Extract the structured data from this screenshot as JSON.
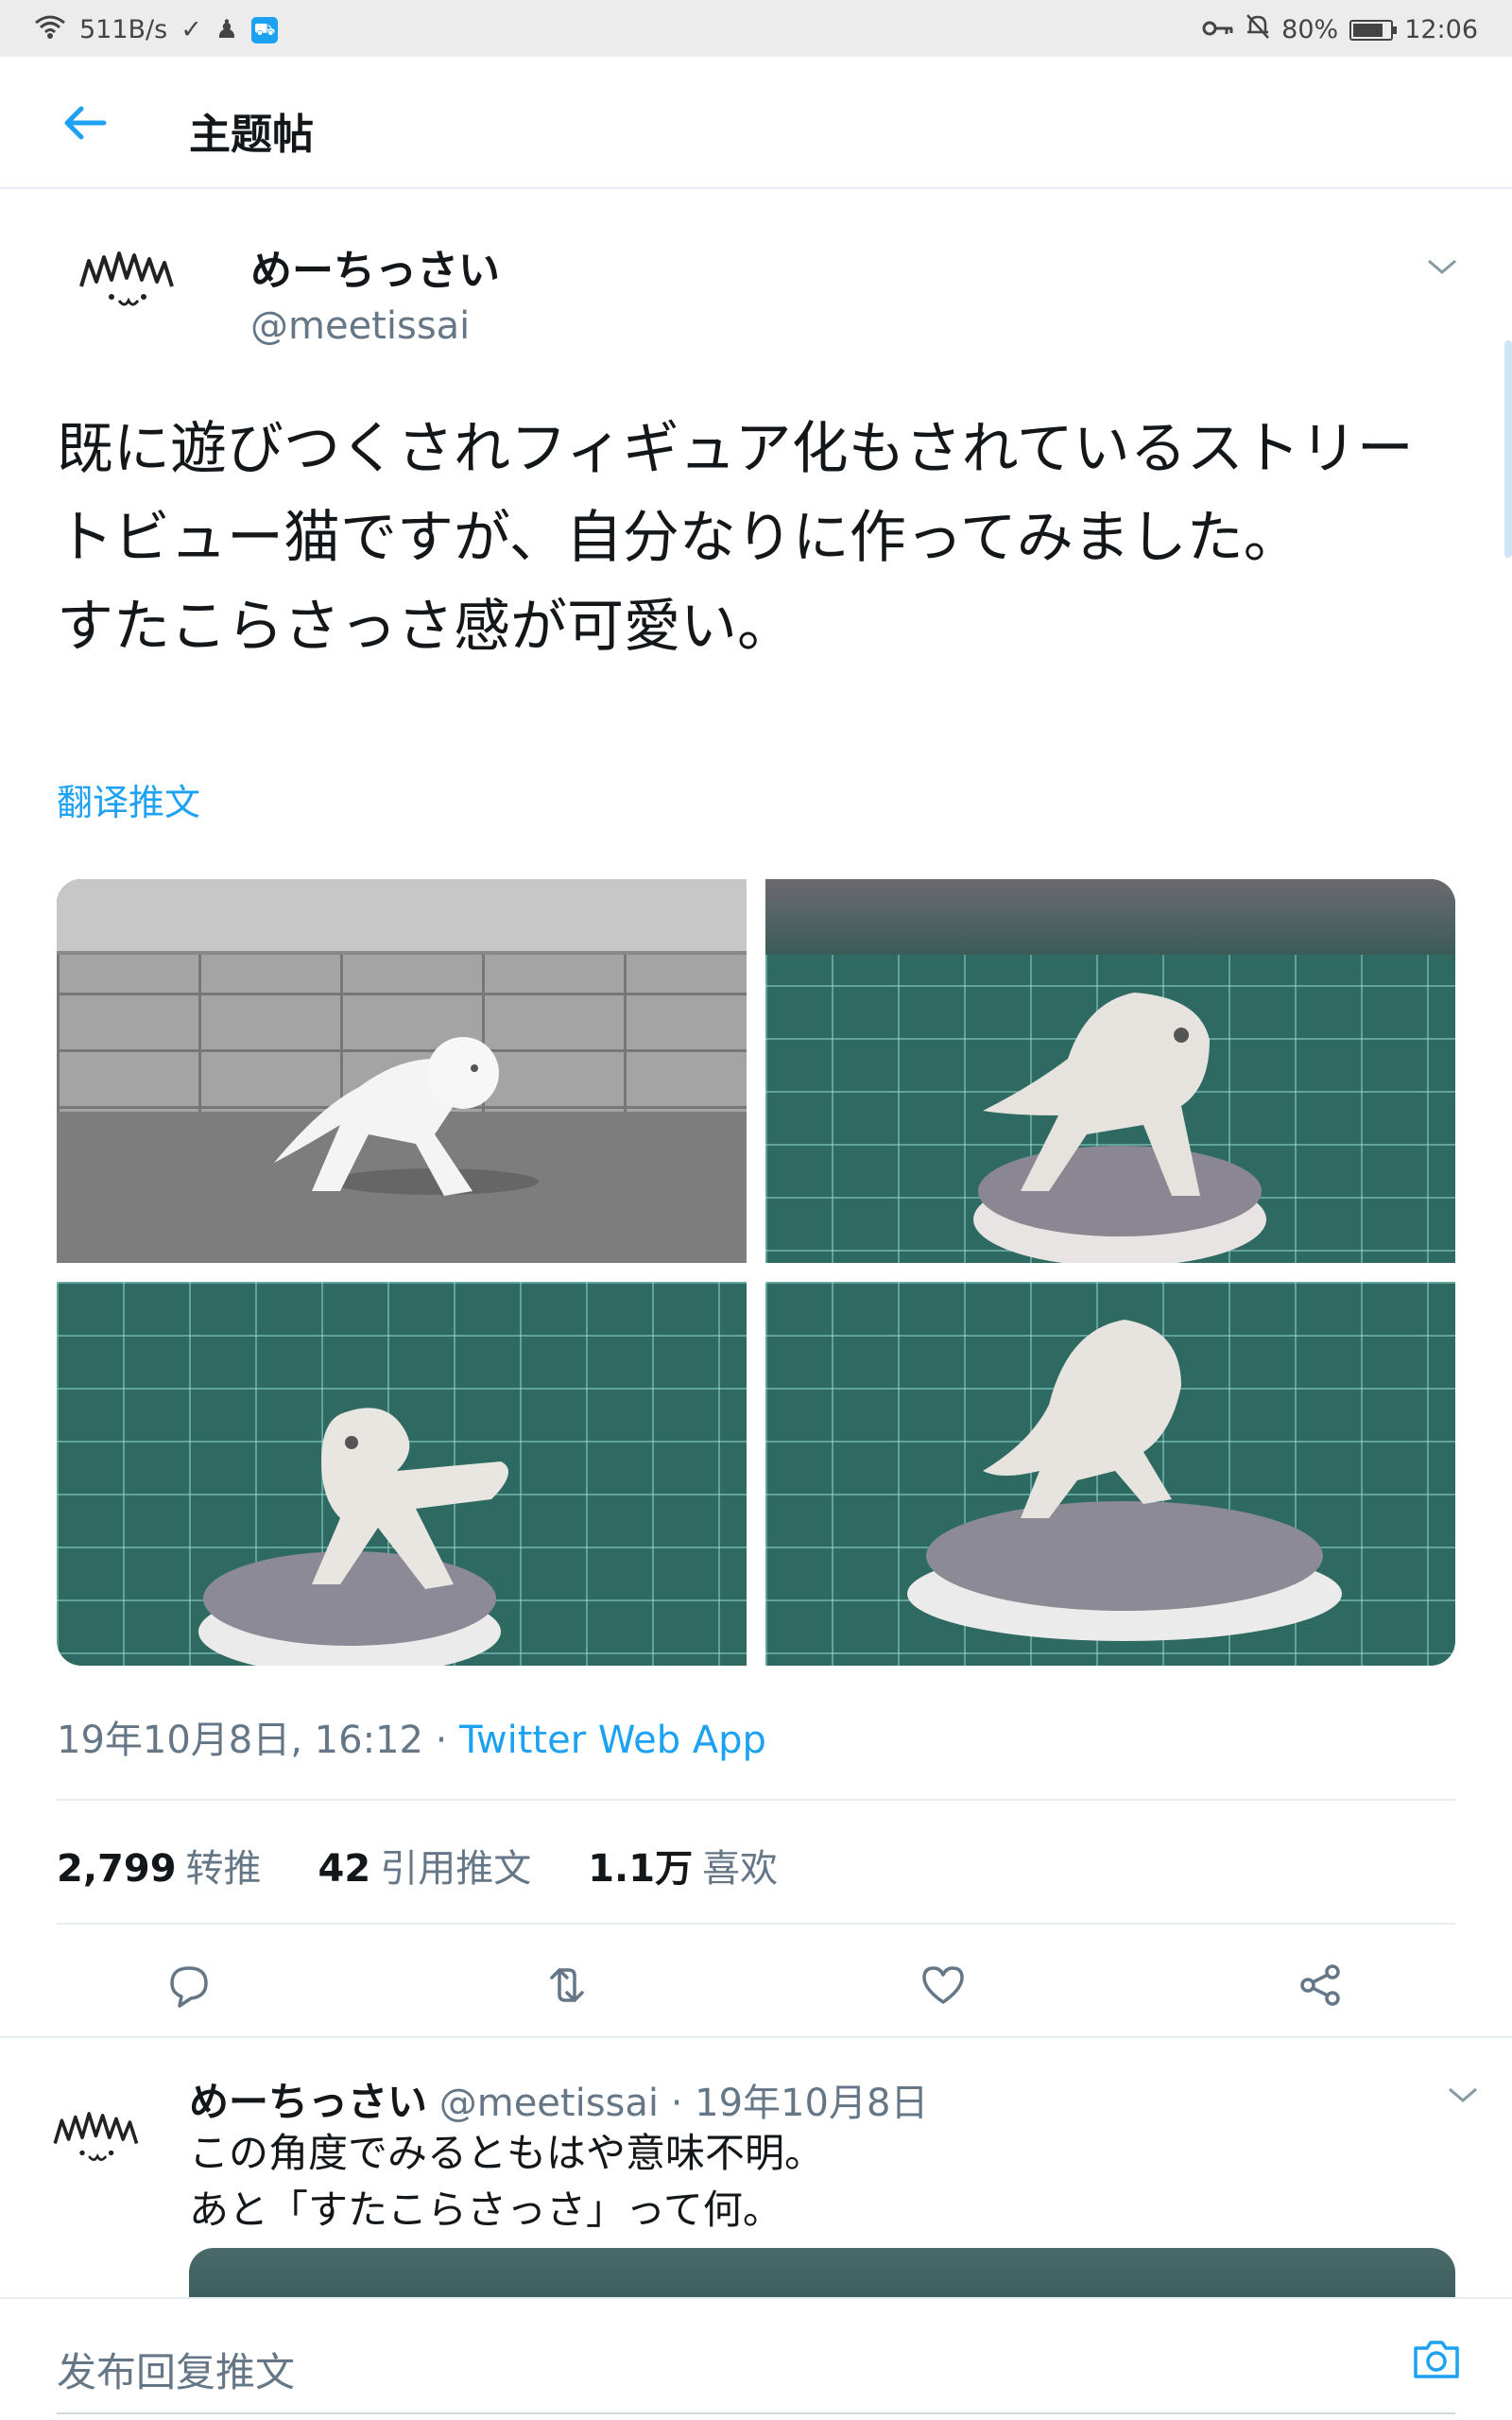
{
  "status_bar": {
    "speed": "511B/s",
    "battery": "80%",
    "battery_level": 0.8,
    "time": "12:06"
  },
  "header": {
    "title": "主题帖"
  },
  "tweet": {
    "author_name": "めーちっさい",
    "author_handle": "@meetissai",
    "text": "既に遊びつくされフィギュア化もされているストリートビュー猫ですが、自分なりに作ってみました。\nすたこらさっさ感が可愛い。",
    "translate_label": "翻译推文",
    "timestamp": "19年10月8日, 16:12 · ",
    "source_app": "Twitter Web App",
    "stats": {
      "retweets_count": "2,799",
      "retweets_label": "转推",
      "quotes_count": "42",
      "quotes_label": "引用推文",
      "likes_count": "1.1万",
      "likes_label": "喜欢"
    },
    "actions": [
      "reply-icon",
      "retweet-icon",
      "like-icon",
      "share-icon"
    ]
  },
  "reply": {
    "author_name": "めーちっさい",
    "meta": " @meetissai · 19年10月8日",
    "text": "この角度でみるともはや意味不明。\nあと「すたこらさっさ」って何。"
  },
  "compose": {
    "placeholder": "发布回复推文"
  },
  "colors": {
    "accent": "#1da1f2",
    "secondary_text": "#657786",
    "divider": "#e6ecf0"
  }
}
